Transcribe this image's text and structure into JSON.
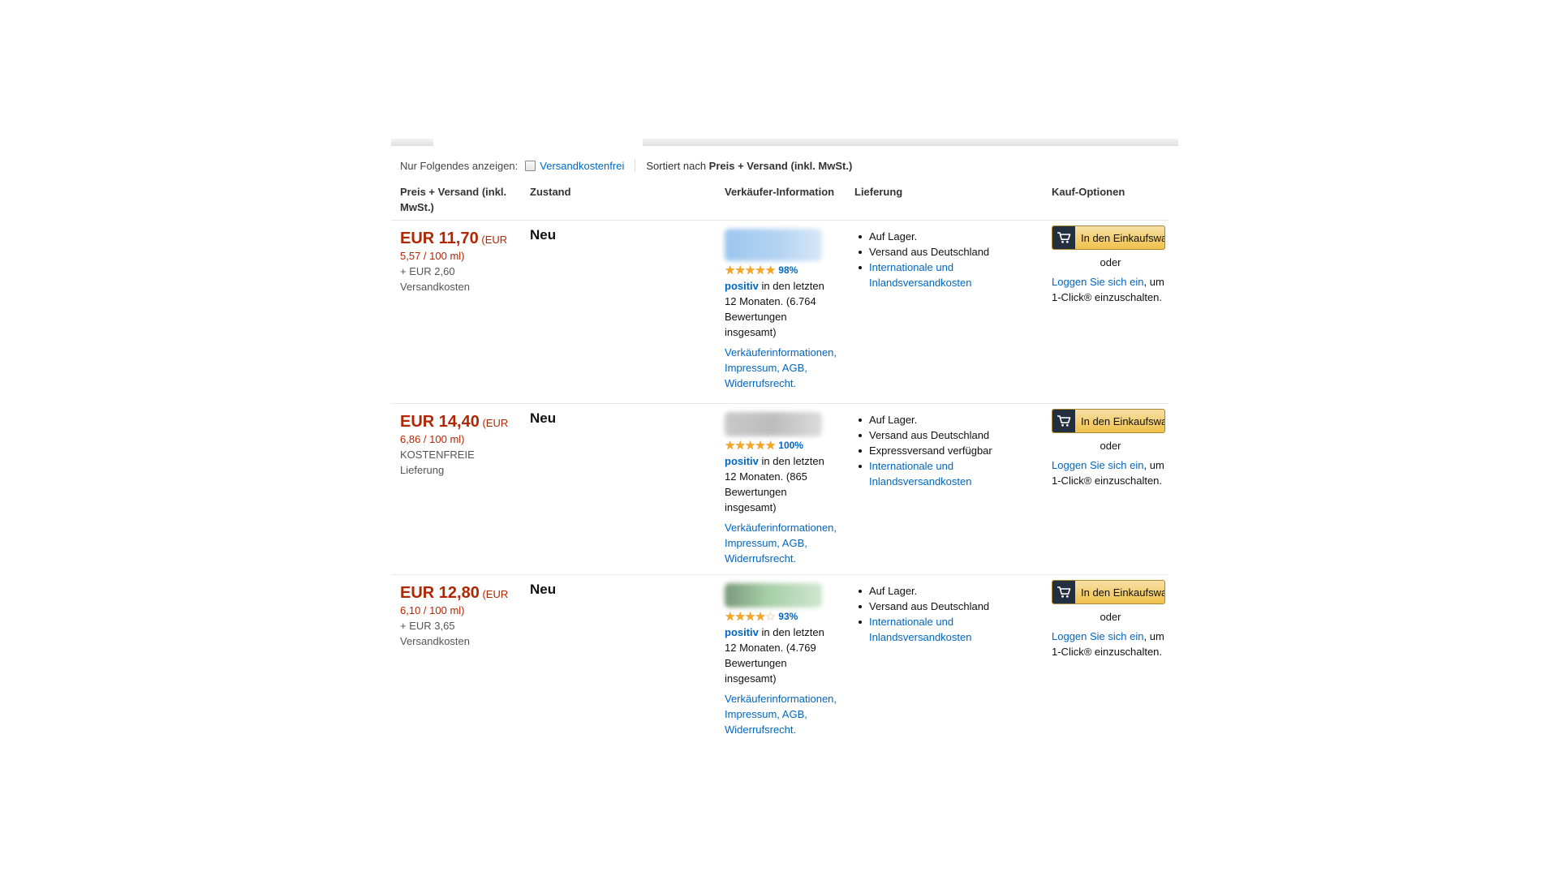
{
  "filter": {
    "label": "Nur Folgendes anzeigen:",
    "free_shipping": "Versandkostenfrei",
    "sort_prefix": "Sortiert nach",
    "sort_value": "Preis + Versand (inkl. MwSt.)"
  },
  "headers": {
    "price": "Preis + Versand (inkl. MwSt.)",
    "condition": "Zustand",
    "seller": "Verkäufer-Information",
    "delivery": "Lieferung",
    "buy": "Kauf-Optionen"
  },
  "offers": [
    {
      "price": "EUR 11,70",
      "unit_a": "(EUR",
      "unit_b": "5,57 / 100 ml)",
      "ship_a": "+ EUR 2,60",
      "ship_b": "Versandkosten",
      "condition": "Neu",
      "rating_stars": 5,
      "rating_pct": "98%",
      "positive": "positiv",
      "rating_text_1": " in den letzten",
      "rating_text_2": "12 Monaten. (6.764",
      "rating_text_3": "Bewertungen",
      "rating_text_4": "insgesamt)",
      "seller_link_1": "Verkäuferinformationen,",
      "seller_link_2": "Impressum, AGB,",
      "seller_link_3": "Widerrufsrecht.",
      "delivery": [
        {
          "text": "Auf Lager.",
          "link": false
        },
        {
          "text": "Versand aus Deutschland",
          "link": false
        },
        {
          "text": "Internationale und",
          "link": true,
          "text2": "Inlandsversandkosten"
        }
      ]
    },
    {
      "price": "EUR 14,40",
      "unit_a": "(EUR",
      "unit_b": "6,86 / 100 ml)",
      "ship_a": "KOSTENFREIE",
      "ship_b": "Lieferung",
      "condition": "Neu",
      "rating_stars": 5,
      "rating_pct": "100%",
      "positive": "positiv",
      "rating_text_1": " in den letzten",
      "rating_text_2": "12 Monaten. (865",
      "rating_text_3": "Bewertungen",
      "rating_text_4": "insgesamt)",
      "seller_link_1": "Verkäuferinformationen,",
      "seller_link_2": "Impressum, AGB,",
      "seller_link_3": "Widerrufsrecht.",
      "delivery": [
        {
          "text": "Auf Lager.",
          "link": false
        },
        {
          "text": "Versand aus Deutschland",
          "link": false
        },
        {
          "text": "Expressversand verfügbar",
          "link": false
        },
        {
          "text": "Internationale und",
          "link": true,
          "text2": "Inlandsversandkosten"
        }
      ]
    },
    {
      "price": "EUR 12,80",
      "unit_a": "(EUR",
      "unit_b": "6,10 / 100 ml)",
      "ship_a": "+ EUR 3,65",
      "ship_b": "Versandkosten",
      "condition": "Neu",
      "rating_stars": 4.5,
      "rating_pct": "93%",
      "positive": "positiv",
      "rating_text_1": " in den letzten",
      "rating_text_2": "12 Monaten. (4.769",
      "rating_text_3": "Bewertungen",
      "rating_text_4": "insgesamt)",
      "seller_link_1": "Verkäuferinformationen,",
      "seller_link_2": "Impressum, AGB,",
      "seller_link_3": "Widerrufsrecht.",
      "delivery": [
        {
          "text": "Auf Lager.",
          "link": false
        },
        {
          "text": "Versand aus Deutschland",
          "link": false
        },
        {
          "text": "Internationale und",
          "link": true,
          "text2": "Inlandsversandkosten"
        }
      ]
    }
  ],
  "buy": {
    "cart_label": "In den Einkaufswa",
    "or": "oder",
    "login_link": "Loggen Sie sich ein",
    "login_rest_1": ", um",
    "login_rest_2": "1-Click® einzuschalten."
  },
  "icons": {
    "cart": "shopping-cart-icon",
    "star": "star-icon",
    "checkbox": "checkbox-icon"
  },
  "colors": {
    "price": "#b12704",
    "link": "#0066c0",
    "button": "#f0c14b",
    "star": "#f5a623"
  }
}
